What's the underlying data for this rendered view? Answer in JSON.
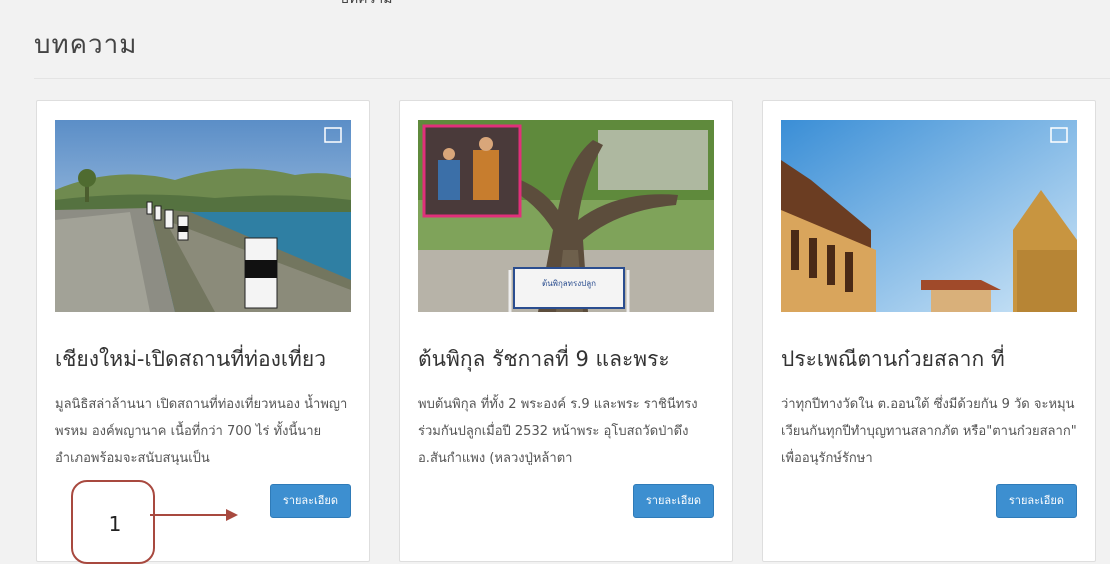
{
  "section": {
    "title": "บทความ"
  },
  "articles": [
    {
      "title": "เชียงใหม่-เปิดสถานที่ท่องเที่ยว",
      "excerpt": "มูลนิธิสล่าล้านนา เปิดสถานที่ท่องเที่ยวหนอง น้ำพญาพรหม องค์พญานาค เนื้อที่กว่า 700 ไร่ ทั้งนี้นายอำเภอพร้อมจะสนับสนุนเป็น",
      "button": "รายละเอียด",
      "image_icon": "landscape-reservoir-photo"
    },
    {
      "title": "ต้นพิกุล รัชกาลที่ 9 และพระ",
      "excerpt": "พบต้นพิกุล ที่ทั้ง 2 พระองค์ ร.9 และพระ ราชินีทรงร่วมกันปลูกเมื่อปี 2532 หน้าพระ อุโบสถวัดป่าดึง อ.สันกำแพง (หลวงปู่หล้าตา",
      "button": "รายละเอียด",
      "image_icon": "tree-photo",
      "sign_text": "ต้นพิกุลทรงปลูก"
    },
    {
      "title": "ประเพณีตานก๋วยสลาก ที่",
      "excerpt": "ว่าทุกปีทางวัดใน ต.ออนใต้ ซึ่งมีด้วยกัน 9 วัด จะหมุน เวียนกันทุกปีทำบุญทานสลากภัต หรือ\"ตานก๋วยสลาก\" เพื่ออนุรักษ์รักษา",
      "button": "รายละเอียด",
      "image_icon": "temple-photo"
    }
  ],
  "annotation": {
    "number": "1"
  },
  "colors": {
    "button": "#3d8fd0",
    "callout": "#a8493f",
    "background": "#f2f2f2"
  }
}
